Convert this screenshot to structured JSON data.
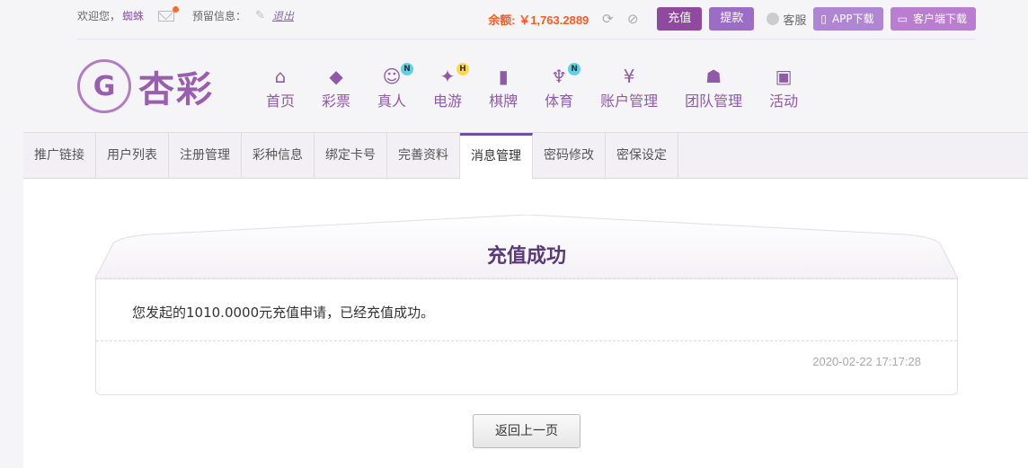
{
  "topbar": {
    "welcome": "欢迎您，",
    "username": "蜘蛛",
    "reserved_info": "预留信息：",
    "logout": "退出",
    "balance": "余额: ￥1,763.2889",
    "recharge": "充值",
    "withdraw": "提款",
    "service": "客服",
    "app_download": "APP下载",
    "client_download": "客户端下载"
  },
  "logo": {
    "mark": "G",
    "text": "杏彩"
  },
  "nav": [
    {
      "label": "首页",
      "icon": "home-icon",
      "glyph": "⌂",
      "badge": ""
    },
    {
      "label": "彩票",
      "icon": "ticket-icon",
      "glyph": "◆",
      "badge": ""
    },
    {
      "label": "真人",
      "icon": "live-dealer-icon",
      "glyph": "☺",
      "badge": "N"
    },
    {
      "label": "电游",
      "icon": "gamepad-icon",
      "glyph": "✦",
      "badge": "H"
    },
    {
      "label": "棋牌",
      "icon": "cards-icon",
      "glyph": "▮",
      "badge": ""
    },
    {
      "label": "体育",
      "icon": "trophy-icon",
      "glyph": "♆",
      "badge": "N"
    },
    {
      "label": "账户管理",
      "icon": "yen-icon",
      "glyph": "¥",
      "badge": ""
    },
    {
      "label": "团队管理",
      "icon": "team-icon",
      "glyph": "☗",
      "badge": ""
    },
    {
      "label": "活动",
      "icon": "gift-icon",
      "glyph": "▣",
      "badge": ""
    }
  ],
  "tabs": [
    {
      "label": "推广链接",
      "active": false
    },
    {
      "label": "用户列表",
      "active": false
    },
    {
      "label": "注册管理",
      "active": false
    },
    {
      "label": "彩种信息",
      "active": false
    },
    {
      "label": "绑定卡号",
      "active": false
    },
    {
      "label": "完善资料",
      "active": false
    },
    {
      "label": "消息管理",
      "active": true
    },
    {
      "label": "密码修改",
      "active": false
    },
    {
      "label": "密保设定",
      "active": false
    }
  ],
  "message": {
    "title": "充值成功",
    "body": "您发起的1010.0000元充值申请，已经充值成功。",
    "date": "2020-02-22 17:17:28"
  },
  "back_button": "返回上一页",
  "colors": {
    "accent": "#8f4aa0",
    "balance": "#ff5a1f",
    "title": "#5a3a78"
  }
}
